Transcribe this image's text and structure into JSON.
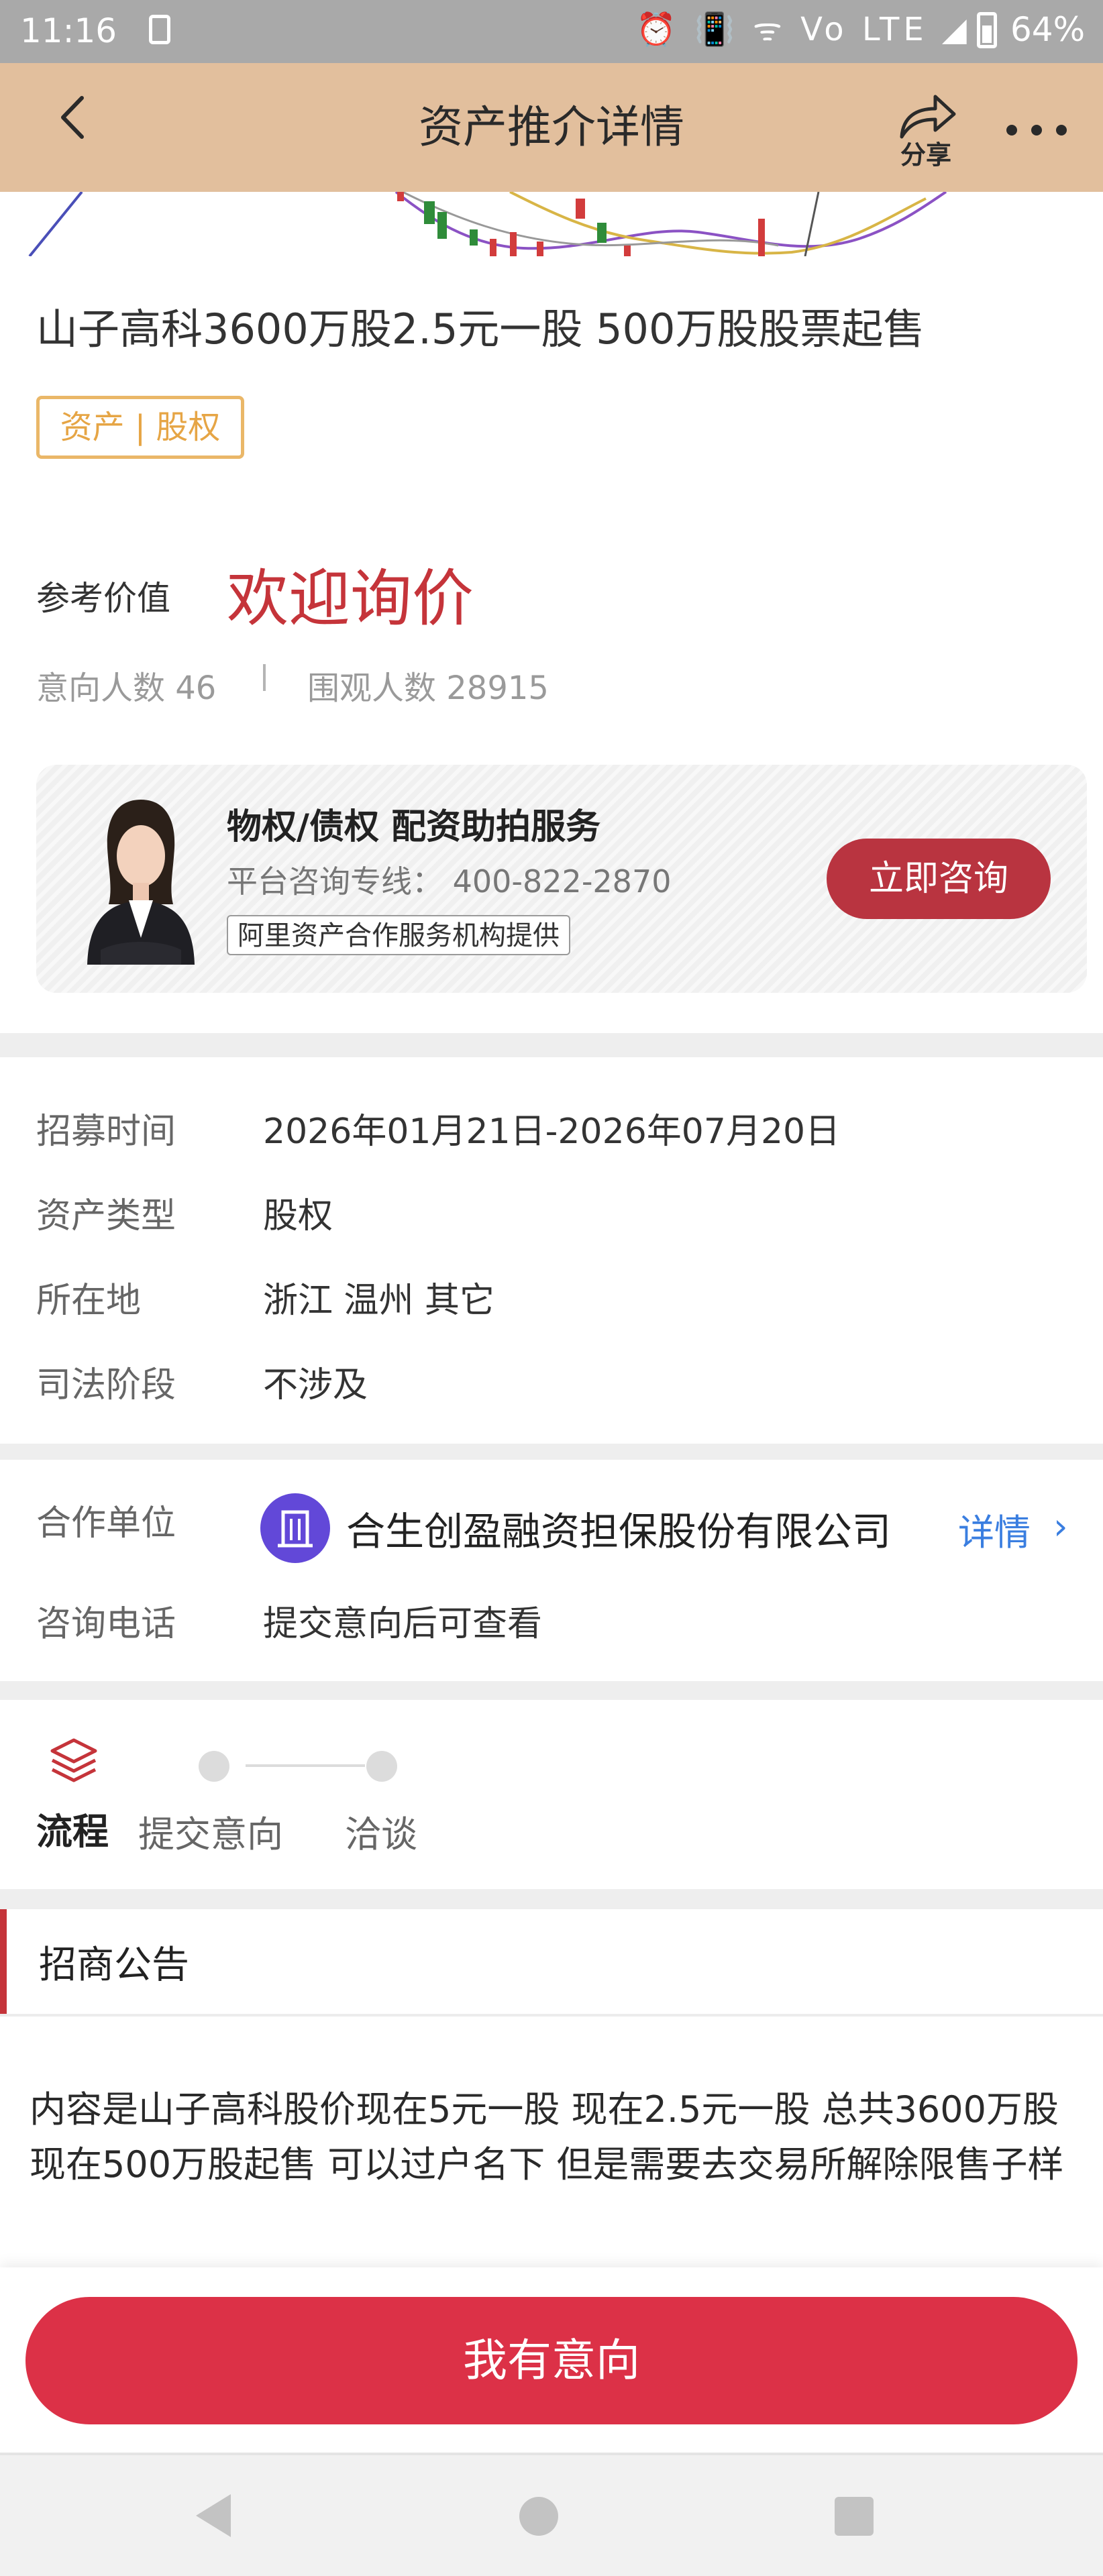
{
  "status_bar": {
    "time": "11:16",
    "network_icons": "⏰ 📳 ᯤ Vo LTE ◢",
    "battery": "64%"
  },
  "top_bar": {
    "title": "资产推介详情",
    "share_label": "分享",
    "back_icon": "chevron-left-icon",
    "more_icon": "more-dots-icon"
  },
  "asset": {
    "title": "山子高科3600万股2.5元一股 500万股股票起售",
    "tag": "资产 | 股权",
    "ref_label": "参考价值",
    "ref_value": "欢迎询价",
    "intent_count": "意向人数 46",
    "watch_count": "围观人数 28915"
  },
  "service": {
    "title": "物权/债权  配资助拍服务",
    "phone": "平台咨询专线： 400-822-2870",
    "provider": "阿里资产合作服务机构提供",
    "button": "立即咨询"
  },
  "details": [
    {
      "label": "招募时间",
      "value": "2026年01月21日-2026年07月20日"
    },
    {
      "label": "资产类型",
      "value": "股权"
    },
    {
      "label": "所在地",
      "value": "浙江 温州 其它"
    },
    {
      "label": "司法阶段",
      "value": "不涉及"
    }
  ],
  "partner": {
    "label": "合作单位",
    "name": "合生创盈融资担保股份有限公司",
    "detail_link": "详情",
    "phone_label": "咨询电话",
    "phone_value": "提交意向后可查看"
  },
  "flow": {
    "label": "流程",
    "steps": [
      "提交意向",
      "洽谈"
    ]
  },
  "notice": {
    "title": "招商公告",
    "body": "内容是山子高科股价现在5元一股 现在2.5元一股   总共3600万股 现在500万股起售  可以过户名下 但是需要去交易所解除限售子样"
  },
  "cta": {
    "label": "我有意向"
  },
  "colors": {
    "topbar": "#e2bf9d",
    "accent_red": "#c5343a",
    "cta_red": "#dc3147",
    "tag_orange": "#e6a545",
    "link_blue": "#3a7ee0",
    "partner_purple": "#6248d8"
  }
}
